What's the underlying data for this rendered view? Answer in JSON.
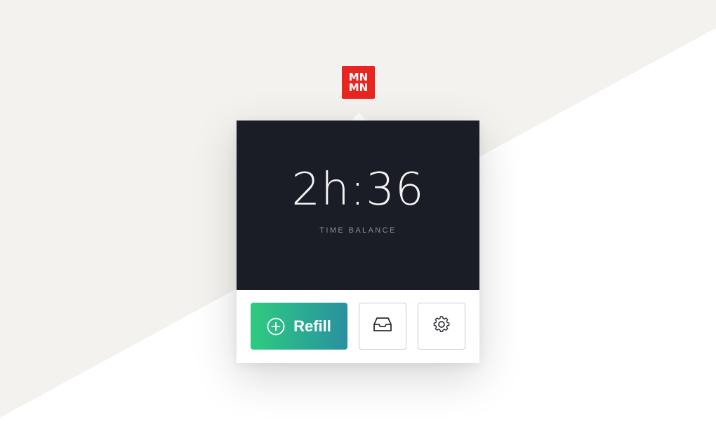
{
  "logo": {
    "line1": "MN",
    "line2": "MN",
    "color": "#e8251e"
  },
  "balance": {
    "time": "2h:36",
    "label": "TIME BALANCE"
  },
  "actions": {
    "refill_label": "Refill",
    "refill_icon": "plus-circle-icon",
    "inbox_icon": "inbox-icon",
    "settings_icon": "gear-icon"
  },
  "colors": {
    "panel": "#1a1d25",
    "accent_start": "#2fcb7f",
    "accent_end": "#2b8fa0"
  }
}
